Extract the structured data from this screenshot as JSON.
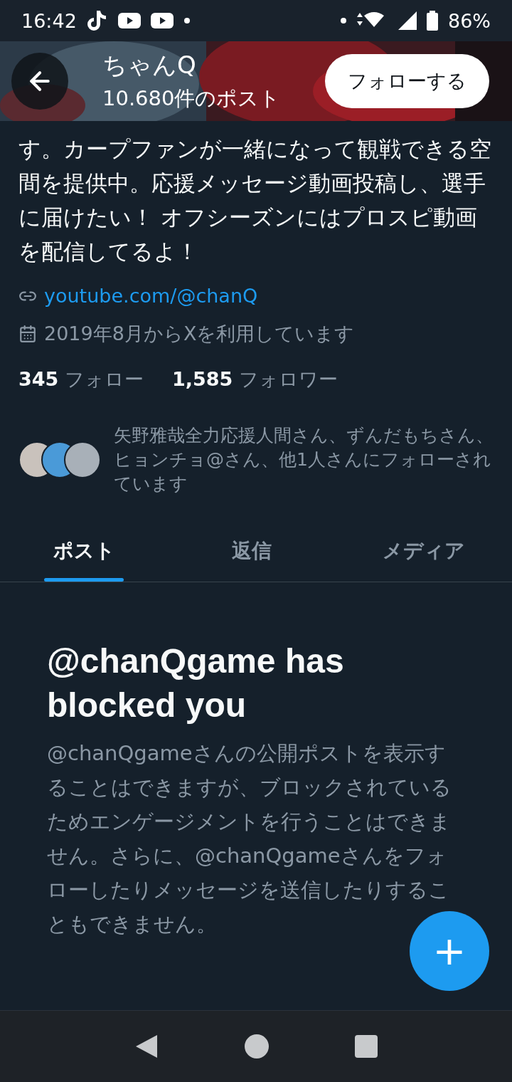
{
  "status_bar": {
    "time": "16:42",
    "battery": "86%"
  },
  "header": {
    "name": "ちゃんQ",
    "post_count": "10.680件のポスト",
    "follow_button": "フォローする"
  },
  "bio": "す。カープファンが一緒になって観戦できる空間を提供中。応援メッセージ動画投稿し、選手に届けたい！ オフシーズンにはプロスピ動画を配信してるよ！",
  "link": "youtube.com/@chanQ",
  "joined": "2019年8月からXを利用しています",
  "stats": [
    "**345** フォロー",
    "**1,585** フォロワー"
  ],
  "followed_by": "矢野雅哉全力応援人間さん、ずんだもちさん、ヒョンチョ@さん、他1人さんにフォローされています",
  "tabs": [
    {
      "label": "ポスト",
      "selected": true
    },
    {
      "label": "返信",
      "selected": false
    },
    {
      "label": "メディア",
      "selected": false
    }
  ],
  "blocked": {
    "title": "@chanQgame has blocked you",
    "message": "@chanQgameさんの公開ポストを表示することはできますが、ブロックされているためエンゲージメントを行うことはできません。さらに、@chanQgameさんをフォローしたりメッセージを送信したりすることもできません。"
  },
  "fab": "+"
}
